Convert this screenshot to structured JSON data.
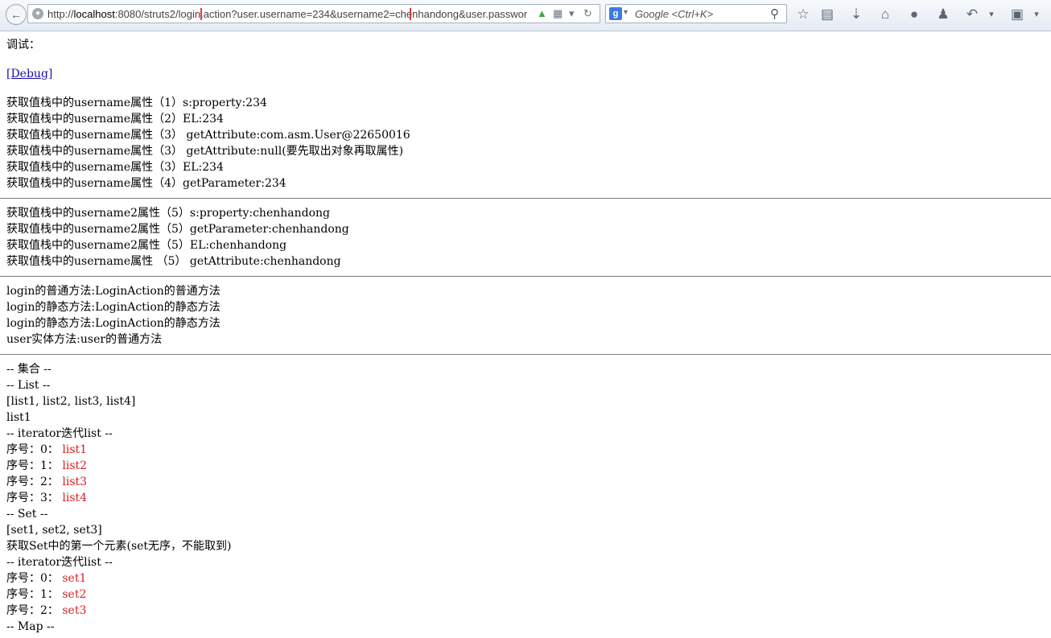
{
  "browser": {
    "url_prefix": "http://",
    "url_host": "localhost",
    "url_path": ":8080/struts2",
    "url_query": "/login.action?user.username=234&username2=chenhandong&user.password",
    "search_placeholder": "Google <Ctrl+K>"
  },
  "page": {
    "title_line": "调试：",
    "debug_link": "[Debug]",
    "section1": [
      "获取值栈中的username属性（1）s:property:234",
      "获取值栈中的username属性（2）EL:234",
      "获取值栈中的username属性（3） getAttribute:com.asm.User@22650016",
      "获取值栈中的username属性（3） getAttribute:null(要先取出对象再取属性)",
      "获取值栈中的username属性（3）EL:234",
      "获取值栈中的username属性（4）getParameter:234"
    ],
    "section2": [
      "获取值栈中的username2属性（5）s:property:chenhandong",
      "获取值栈中的username2属性（5）getParameter:chenhandong",
      "获取值栈中的username2属性（5）EL:chenhandong",
      "获取值栈中的username属性 （5） getAttribute:chenhandong"
    ],
    "section3": [
      "login的普通方法:LoginAction的普通方法",
      "login的静态方法:LoginAction的静态方法",
      "login的静态方法:LoginAction的静态方法",
      "user实体方法:user的普通方法"
    ],
    "collection_header": "-- 集合 --",
    "list_header": "-- List --",
    "list_value": "[list1, list2, list3, list4]",
    "list_first": "list1",
    "list_iter_header": "-- iterator迭代list --",
    "list_items": [
      {
        "label": "序号：0： ",
        "value": "list1"
      },
      {
        "label": "序号：1： ",
        "value": "list2"
      },
      {
        "label": "序号：2： ",
        "value": "list3"
      },
      {
        "label": "序号：3： ",
        "value": "list4"
      }
    ],
    "set_header": "-- Set --",
    "set_value": "[set1, set2, set3]",
    "set_note": "获取Set中的第一个元素(set无序，不能取到)",
    "set_iter_header": "-- iterator迭代list --",
    "set_items": [
      {
        "label": "序号：0： ",
        "value": "set1"
      },
      {
        "label": "序号：1： ",
        "value": "set2"
      },
      {
        "label": "序号：2： ",
        "value": "set3"
      }
    ],
    "map_header": "-- Map --"
  },
  "colors": {
    "highlight_box": "#e13a3a",
    "iter_value": "#d92020",
    "link": "#1a0dab"
  }
}
